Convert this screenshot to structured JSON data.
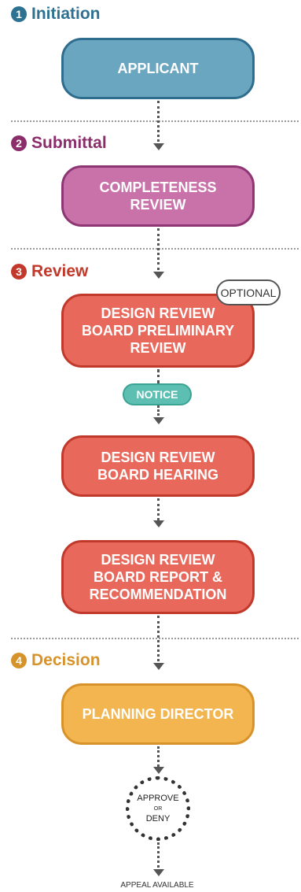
{
  "stages": [
    {
      "number": "1",
      "title": "Initiation",
      "color": "#2e7190"
    },
    {
      "number": "2",
      "title": "Submittal",
      "color": "#8b2d6b"
    },
    {
      "number": "3",
      "title": "Review",
      "color": "#c2392b"
    },
    {
      "number": "4",
      "title": "Decision",
      "color": "#d7932b"
    }
  ],
  "steps": [
    {
      "label": "APPLICANT",
      "fill": "#6ba6c1",
      "border": "#2f6d8e"
    },
    {
      "label": "COMPLETENESS\nREVIEW",
      "fill": "#c972aa",
      "border": "#8e3573"
    },
    {
      "label": "DESIGN REVIEW\nBOARD PRELIMINARY\nREVIEW",
      "fill": "#e8695c",
      "border": "#c1392b"
    },
    {
      "label": "DESIGN REVIEW\nBOARD HEARING",
      "fill": "#e8695c",
      "border": "#c1392b"
    },
    {
      "label": "DESIGN REVIEW\nBOARD REPORT &\nRECOMMENDATION",
      "fill": "#e8695c",
      "border": "#c1392b"
    },
    {
      "label": "PLANNING DIRECTOR",
      "fill": "#f2b54f",
      "border": "#d8922a"
    }
  ],
  "optional_label": "OPTIONAL",
  "notice_label": "NOTICE",
  "outcome": {
    "line1": "APPROVE",
    "line2": "OR",
    "line3": "DENY"
  },
  "footer": "APPEAL AVAILABLE"
}
